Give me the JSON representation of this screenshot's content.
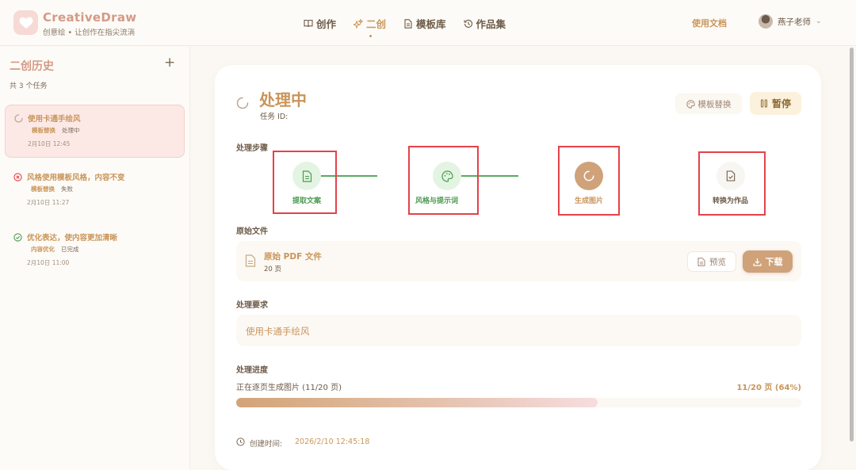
{
  "app": {
    "name": "CreativeDraw",
    "tagline": "创意绘 • 让创作在指尖流淌"
  },
  "nav": {
    "items": [
      {
        "label": "创作",
        "icon": "book-icon"
      },
      {
        "label": "二创",
        "icon": "sparkle-icon",
        "active": true
      },
      {
        "label": "模板库",
        "icon": "document-icon"
      },
      {
        "label": "作品集",
        "icon": "history-icon"
      }
    ],
    "docs": "使用文档",
    "user": "燕子老师"
  },
  "sidebar": {
    "title": "二创历史",
    "count": "共 3 个任务",
    "tasks": [
      {
        "title": "使用卡通手绘风",
        "tag": "模板替换",
        "status": "处理中",
        "time": "2月10日 12:45",
        "state": "processing"
      },
      {
        "title": "风格使用模板风格，内容不变",
        "tag": "模板替换",
        "status": "失败",
        "time": "2月10日 11:27",
        "state": "failed"
      },
      {
        "title": "优化表达，使内容更加清晰",
        "tag": "内容优化",
        "status": "已完成",
        "time": "2月10日 11:00",
        "state": "done"
      }
    ]
  },
  "main": {
    "status": "处理中",
    "task_id_label": "任务 ID:",
    "template_button": "模板替换",
    "pause_button": "暂停",
    "steps_label": "处理步骤",
    "steps": [
      {
        "label": "提取文案",
        "state": "done",
        "icon": "document-icon"
      },
      {
        "label": "风格与提示词",
        "state": "done",
        "icon": "palette-icon"
      },
      {
        "label": "生成图片",
        "state": "current",
        "icon": "spinner-icon"
      },
      {
        "label": "转换为作品",
        "state": "pending",
        "icon": "file-check-icon"
      }
    ],
    "file_label": "原始文件",
    "file": {
      "name": "原始 PDF 文件",
      "pages": "20 页",
      "preview": "预览",
      "download": "下载"
    },
    "requirement_label": "处理要求",
    "requirement": "使用卡通手绘风",
    "progress_label": "处理进度",
    "progress_text": "正在逐页生成图片 (11/20 页)",
    "progress_value": "11/20 页 (64%)",
    "progress_fraction": 0.64,
    "created_label": "创建时间:",
    "created_time": "2026/2/10 12:45:18"
  },
  "colors": {
    "accent": "#c9955a",
    "brand": "#d49a86",
    "success": "#4b9a50",
    "error": "#e5414a",
    "progress_fill": "#d2a476"
  }
}
